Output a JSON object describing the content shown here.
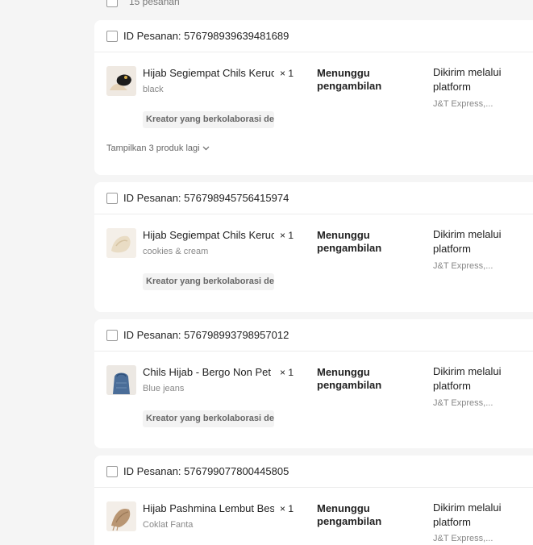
{
  "summary": {
    "count_text": "15 pesanan"
  },
  "orders": [
    {
      "id_text": "ID Pesanan: 576798939639481689",
      "product_name": "Hijab Segiempat Chils Kerudung",
      "quantity": "× 1",
      "variant": "black",
      "creator_badge": "Kreator yang berkolaborasi dengan Anda",
      "status": "Menunggu pengambilan",
      "shipping": "Dikirim melalui platform",
      "courier": "J&T Express,...",
      "more_link": "Tampilkan 3 produk lagi"
    },
    {
      "id_text": "ID Pesanan: 576798945756415974",
      "product_name": "Hijab Segiempat Chils Kerudung",
      "quantity": "× 1",
      "variant": "cookies & cream",
      "creator_badge": "Kreator yang berkolaborasi dengan Anda",
      "status": "Menunggu pengambilan",
      "shipping": "Dikirim melalui platform",
      "courier": "J&T Express,..."
    },
    {
      "id_text": "ID Pesanan: 576798993798957012",
      "product_name": "Chils Hijab - Bergo Non Pet Instan",
      "quantity": "× 1",
      "variant": "Blue jeans",
      "creator_badge": "Kreator yang berkolaborasi dengan Anda",
      "status": "Menunggu pengambilan",
      "shipping": "Dikirim melalui platform",
      "courier": "J&T Express,..."
    },
    {
      "id_text": "ID Pesanan: 576799077800445805",
      "product_name": "Hijab Pashmina Lembut Best Seller",
      "quantity": "× 1",
      "variant": "Coklat Fanta",
      "status": "Menunggu pengambilan",
      "shipping": "Dikirim melalui platform",
      "courier": "J&T Express,..."
    }
  ]
}
